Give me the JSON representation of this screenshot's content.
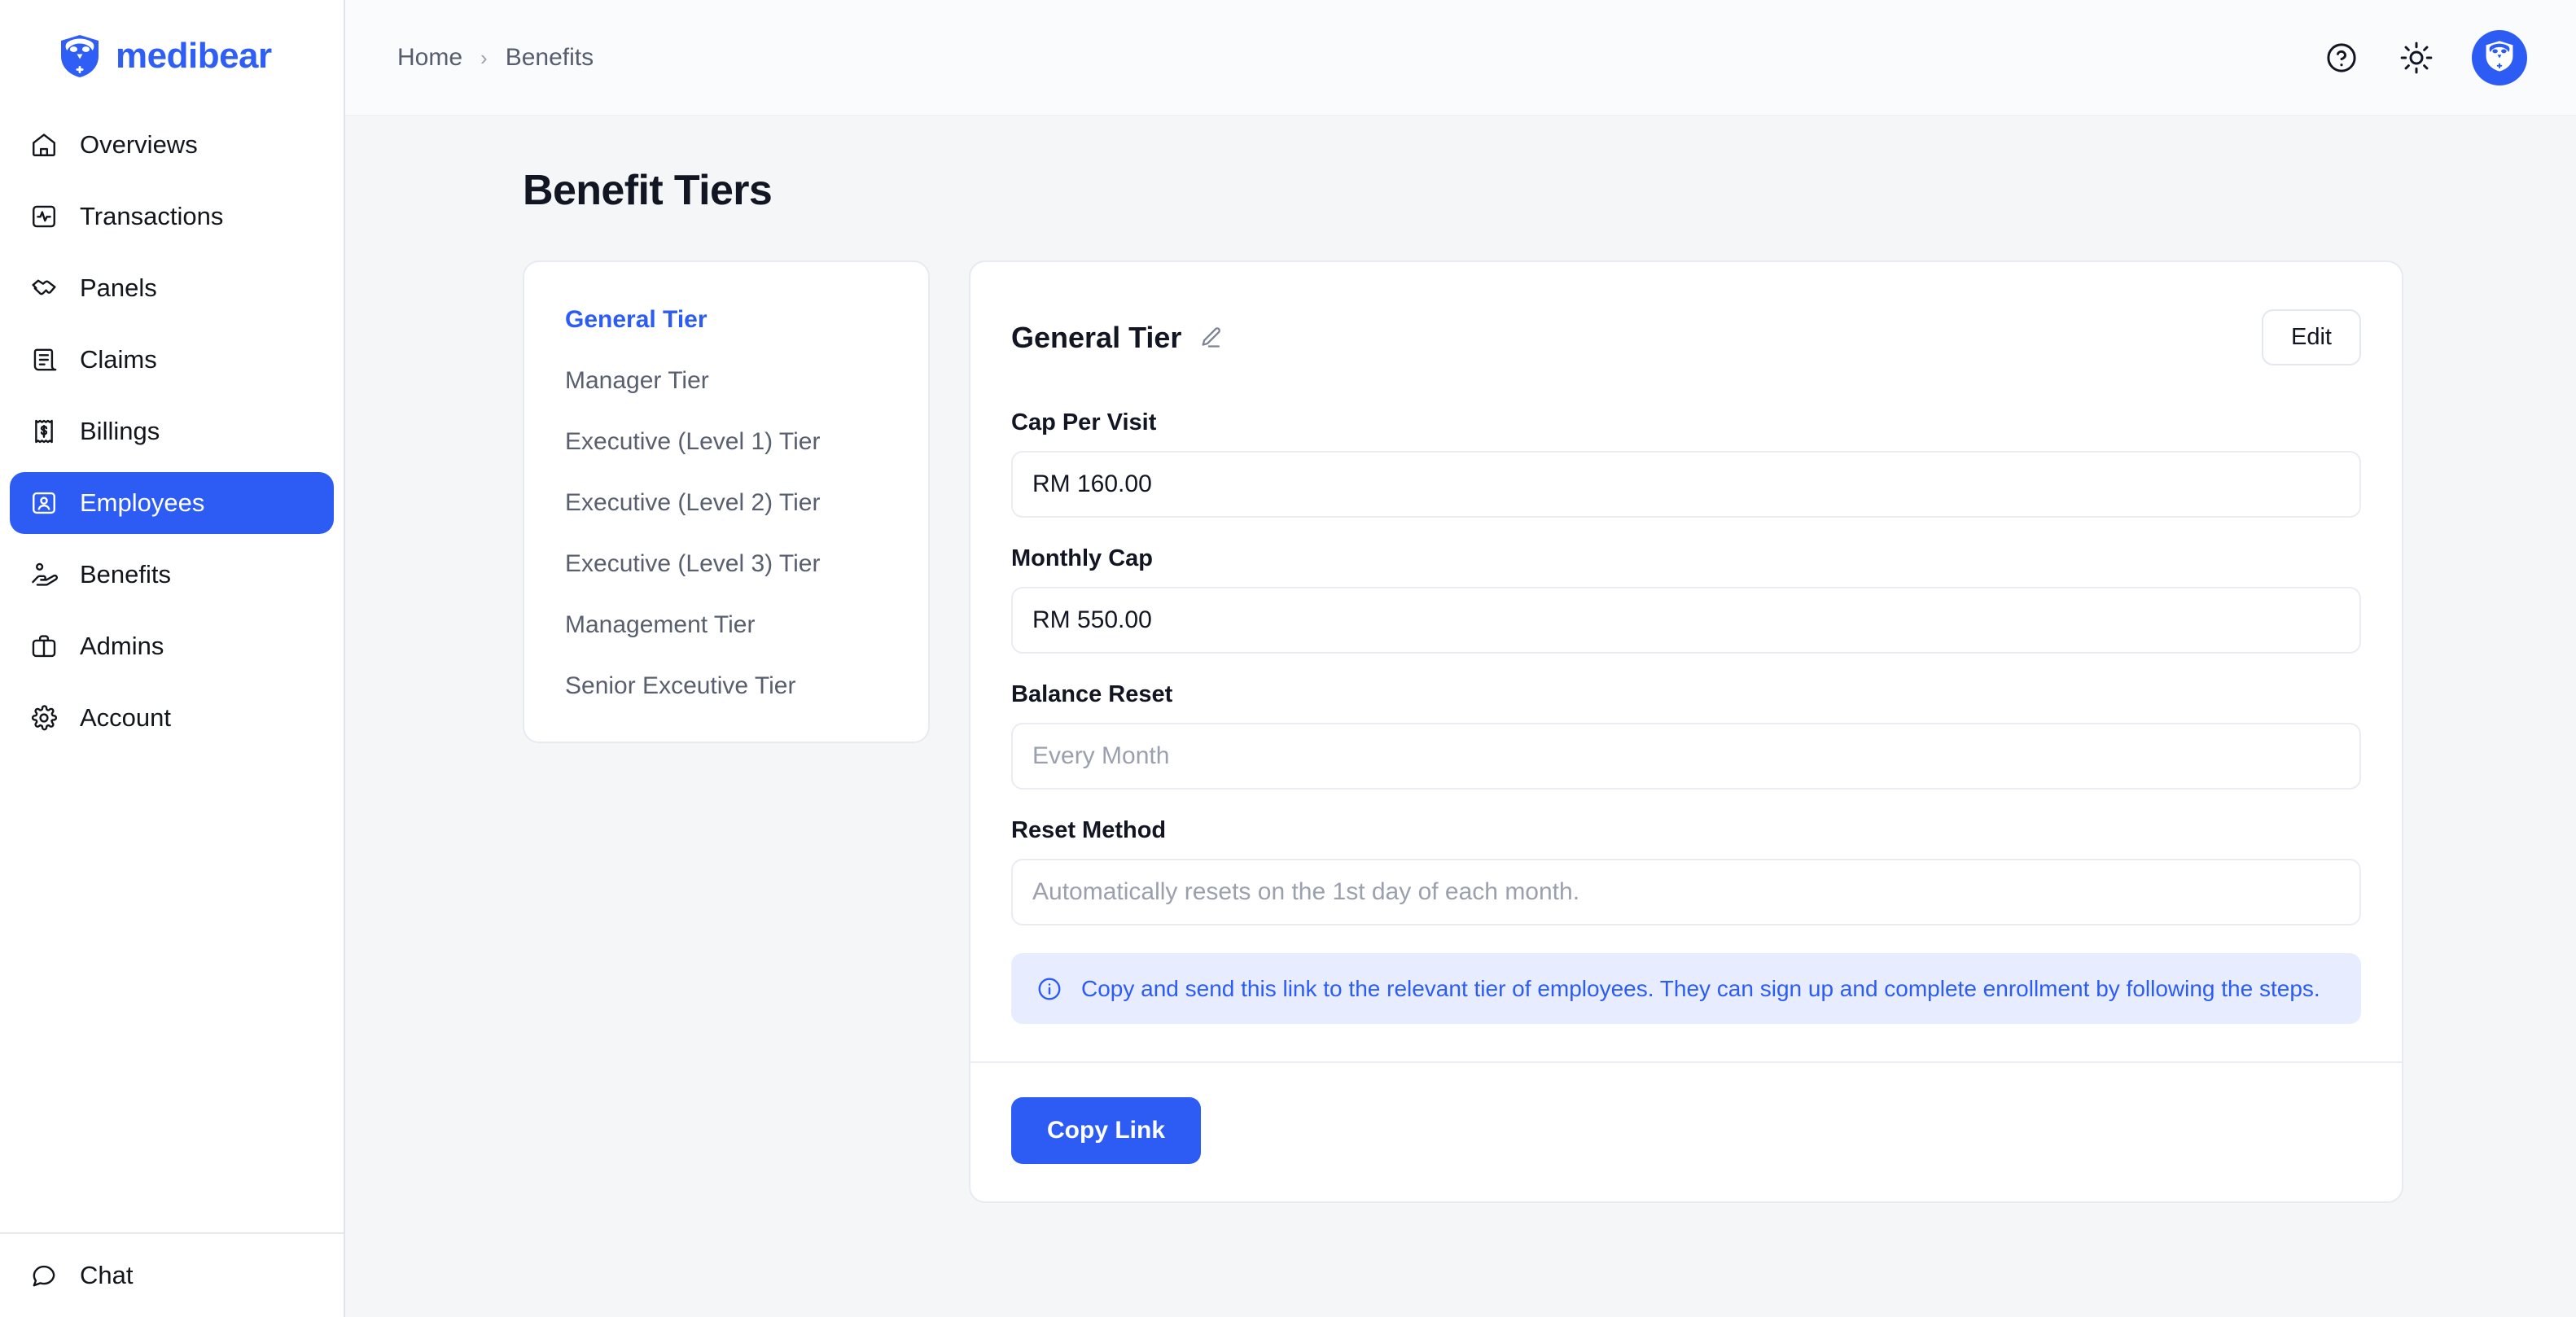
{
  "brand": {
    "name": "medibear",
    "logo_icon": "bear-shield-logo",
    "accent_color": "#2c5cf4"
  },
  "sidebar": {
    "items": [
      {
        "label": "Overviews",
        "icon": "home-icon",
        "active": false
      },
      {
        "label": "Transactions",
        "icon": "activity-monitor-icon",
        "active": false
      },
      {
        "label": "Panels",
        "icon": "handshake-icon",
        "active": false
      },
      {
        "label": "Claims",
        "icon": "scroll-document-icon",
        "active": false
      },
      {
        "label": "Billings",
        "icon": "receipt-dollar-icon",
        "active": false
      },
      {
        "label": "Employees",
        "icon": "id-card-icon",
        "active": true
      },
      {
        "label": "Benefits",
        "icon": "hand-heart-icon",
        "active": false
      },
      {
        "label": "Admins",
        "icon": "briefcase-icon",
        "active": false
      },
      {
        "label": "Account",
        "icon": "gear-icon",
        "active": false
      }
    ],
    "footer": {
      "label": "Chat",
      "icon": "chat-bubble-icon"
    }
  },
  "topbar": {
    "breadcrumb": [
      "Home",
      "Benefits"
    ],
    "separator": "›",
    "help_icon": "help-circle-icon",
    "theme_icon": "sun-icon",
    "avatar_icon": "bear-shield-avatar"
  },
  "page": {
    "title": "Benefit Tiers"
  },
  "tier_list": {
    "items": [
      {
        "label": "General Tier",
        "active": true
      },
      {
        "label": "Manager Tier",
        "active": false
      },
      {
        "label": "Executive (Level 1) Tier",
        "active": false
      },
      {
        "label": "Executive (Level 2) Tier",
        "active": false
      },
      {
        "label": "Executive (Level 3) Tier",
        "active": false
      },
      {
        "label": "Management Tier",
        "active": false
      },
      {
        "label": "Senior Exceutive Tier",
        "active": false
      }
    ]
  },
  "detail": {
    "title": "General Tier",
    "edit_pencil_icon": "pencil-edit-icon",
    "edit_button": "Edit",
    "fields": [
      {
        "label": "Cap Per Visit",
        "value": "RM 160.00",
        "placeholder": "",
        "is_placeholder": false
      },
      {
        "label": "Monthly Cap",
        "value": "RM 550.00",
        "placeholder": "",
        "is_placeholder": false
      },
      {
        "label": "Balance Reset",
        "value": "",
        "placeholder": "Every Month",
        "is_placeholder": true
      },
      {
        "label": "Reset Method",
        "value": "",
        "placeholder": "Automatically resets on the 1st day of each month.",
        "is_placeholder": true
      }
    ],
    "info_banner": {
      "icon": "info-circle-icon",
      "text": "Copy and send this link to the relevant tier of employees. They can sign up and complete enrollment by following the steps.",
      "background_color": "#e7edfe",
      "text_color": "#2c5cf4"
    },
    "copy_button": "Copy Link"
  }
}
